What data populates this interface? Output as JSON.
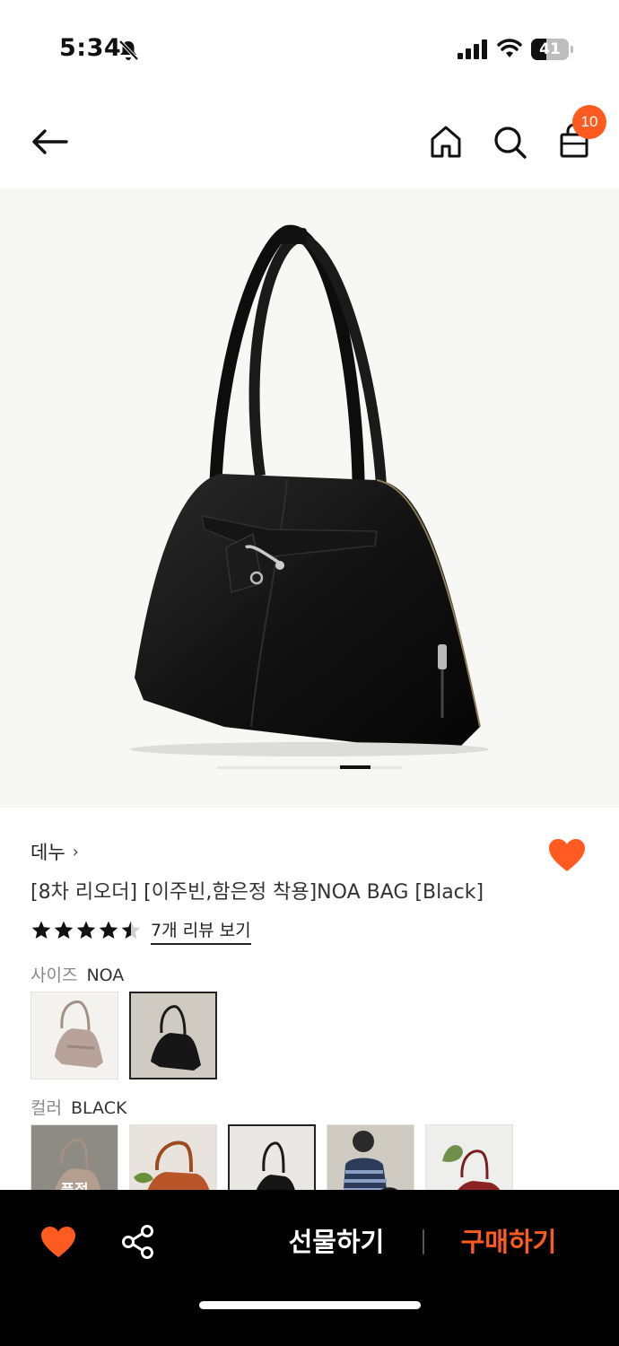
{
  "status_bar": {
    "time": "5:34",
    "battery": "41",
    "battery_level": 0.41,
    "icons": [
      "bell-slash-icon",
      "cellular-signal-icon",
      "wifi-icon",
      "battery-icon"
    ]
  },
  "header": {
    "icons": [
      "arrow-left-icon",
      "home-icon",
      "search-icon",
      "shopping-bag-icon"
    ],
    "cart_count": "10"
  },
  "product_image": {
    "current_page": 5,
    "total_pages": 6
  },
  "product": {
    "brand": "데누",
    "brand_chevron": "›",
    "title": "[8차 리오더] [이주빈,함은정 착용]NOA BAG [Black]",
    "rating": 4.5,
    "rating_max": 5,
    "review_link": "7개 리뷰 보기",
    "wishlisted": true
  },
  "options": {
    "size": {
      "label": "사이즈",
      "value": "NOA",
      "thumbs": [
        {
          "name": "size-thumb-taupe",
          "selected": false
        },
        {
          "name": "size-thumb-black",
          "selected": true
        }
      ]
    },
    "color": {
      "label": "컬러",
      "value": "BLACK",
      "thumbs": [
        {
          "name": "color-thumb-1",
          "overlay_text": "품절",
          "selected": false
        },
        {
          "name": "color-thumb-2",
          "selected": false
        },
        {
          "name": "color-thumb-3",
          "selected": true
        },
        {
          "name": "color-thumb-4",
          "selected": false
        },
        {
          "name": "color-thumb-5",
          "selected": false
        }
      ]
    }
  },
  "bottom_bar": {
    "gift_label": "선물하기",
    "buy_label": "구매하기",
    "icons": [
      "heart-icon",
      "share-icon"
    ]
  },
  "colors": {
    "accent": "#ff5a1f",
    "bottom_bar_bg": "#000000",
    "image_bg": "#f7f7f5"
  }
}
